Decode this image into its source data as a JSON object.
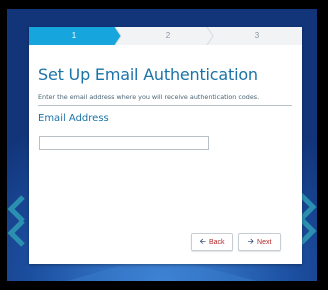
{
  "wizard": {
    "steps": [
      {
        "label": "1",
        "state": "active"
      },
      {
        "label": "2",
        "state": "inactive"
      },
      {
        "label": "3",
        "state": "inactive"
      }
    ],
    "title": "Set Up Email Authentication",
    "subtitle": "Enter the email address where you will receive authentication codes.",
    "email_label": "Email Address",
    "email_value": "",
    "back_label": "Back",
    "back_icon": "arrow-left-icon",
    "next_label": "Next",
    "next_icon": "arrow-right-icon"
  },
  "colors": {
    "accent": "#1a74a8",
    "active_step": "#16a5dc",
    "background": "#143e8c",
    "button_text": "#b22a2a"
  }
}
